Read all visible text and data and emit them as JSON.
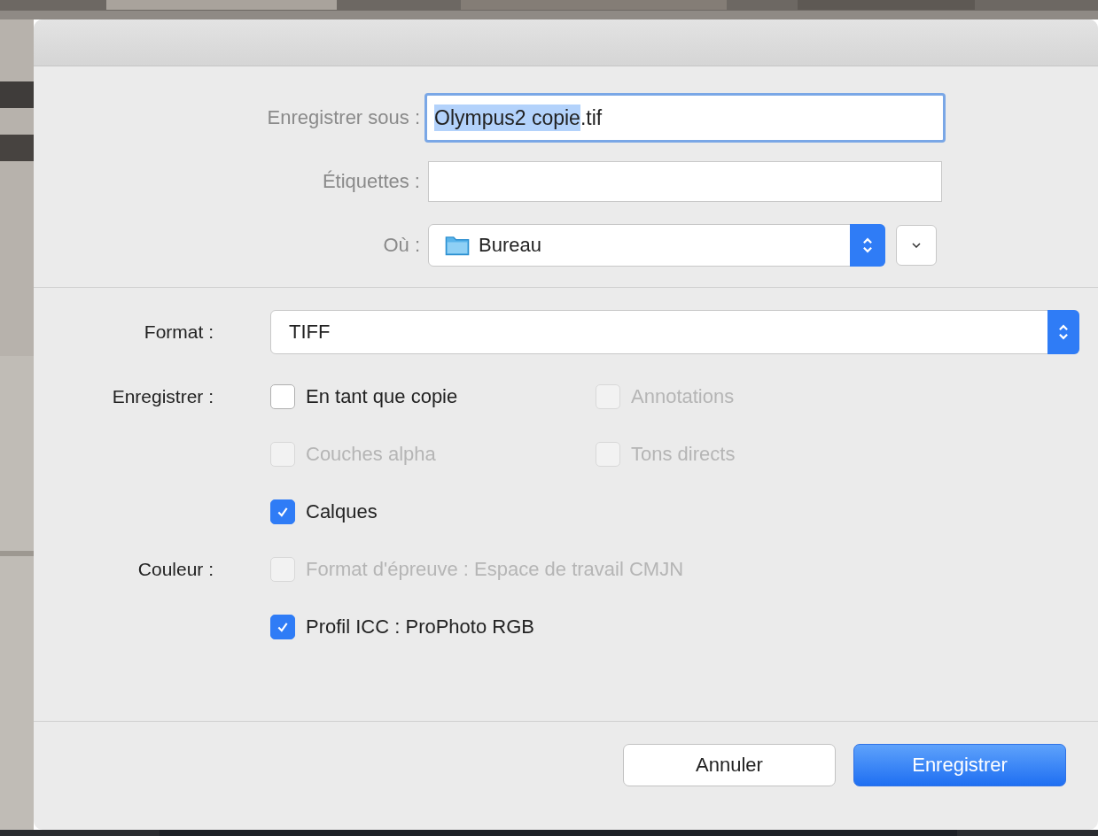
{
  "save_as": {
    "label": "Enregistrer sous :",
    "value": "Olympus2 copie.tif",
    "focused": true,
    "name_selected": true
  },
  "tags": {
    "label": "Étiquettes :"
  },
  "location": {
    "label": "Où :",
    "value": "Bureau",
    "expanded": false
  },
  "format": {
    "label": "Format :",
    "value": "TIFF"
  },
  "option_rows": [
    {
      "label": "Enregistrer :",
      "items": [
        {
          "text": "En tant que copie",
          "checked": false,
          "disabled": false
        },
        {
          "text": "Annotations",
          "checked": false,
          "disabled": true
        }
      ]
    },
    {
      "items": [
        {
          "text": "Couches alpha",
          "checked": false,
          "disabled": true
        },
        {
          "text": "Tons directs",
          "checked": false,
          "disabled": true
        }
      ]
    },
    {
      "items": [
        {
          "text": "Calques",
          "checked": true,
          "disabled": false
        }
      ]
    },
    {
      "label": "Couleur :",
      "items": [
        {
          "text": "Format d'épreuve : Espace de travail CMJN",
          "checked": false,
          "disabled": true
        }
      ]
    },
    {
      "items": [
        {
          "text": "Profil ICC : ProPhoto RGB",
          "checked": true,
          "disabled": false
        }
      ]
    }
  ],
  "buttons": [
    {
      "label": "Annuler",
      "default": false
    },
    {
      "label": "Enregistrer",
      "default": true
    }
  ]
}
